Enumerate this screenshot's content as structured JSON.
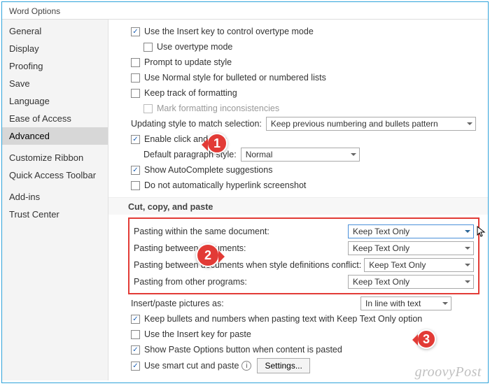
{
  "window": {
    "title": "Word Options"
  },
  "sidebar": {
    "groups": [
      {
        "items": [
          "General",
          "Display",
          "Proofing",
          "Save",
          "Language",
          "Ease of Access",
          "Advanced"
        ]
      },
      {
        "items": [
          "Customize Ribbon",
          "Quick Access Toolbar"
        ]
      },
      {
        "items": [
          "Add-ins",
          "Trust Center"
        ]
      }
    ],
    "selected": "Advanced"
  },
  "editing": {
    "insert_key": "Use the Insert key to control overtype mode",
    "overtype": "Use overtype mode",
    "prompt_update": "Prompt to update style",
    "normal_style": "Use Normal style for bulleted or numbered lists",
    "keep_track": "Keep track of formatting",
    "mark_incons": "Mark formatting inconsistencies",
    "update_style_label": "Updating style to match selection:",
    "update_style_value": "Keep previous numbering and bullets pattern",
    "click_type": "Enable click and type",
    "default_para_label": "Default paragraph style:",
    "default_para_value": "Normal",
    "autocomplete": "Show AutoComplete suggestions",
    "no_auto_hyperlink": "Do not automatically hyperlink screenshot"
  },
  "paste": {
    "heading": "Cut, copy, and paste",
    "rows": [
      {
        "label": "Pasting within the same document:",
        "value": "Keep Text Only"
      },
      {
        "label": "Pasting between documents:",
        "value": "Keep Text Only"
      },
      {
        "label": "Pasting between documents when style definitions conflict:",
        "value": "Keep Text Only"
      },
      {
        "label": "Pasting from other programs:",
        "value": "Keep Text Only"
      }
    ],
    "insert_pics_label": "Insert/paste pictures as:",
    "insert_pics_value": "In line with text",
    "keep_bullets": "Keep bullets and numbers when pasting text with Keep Text Only option",
    "insert_key_paste": "Use the Insert key for paste",
    "show_paste_options": "Show Paste Options button when content is pasted",
    "smart_cut": "Use smart cut and paste",
    "settings_btn": "Settings..."
  },
  "callouts": {
    "c1": "1",
    "c2": "2",
    "c3": "3"
  },
  "watermark": "groovyPost"
}
